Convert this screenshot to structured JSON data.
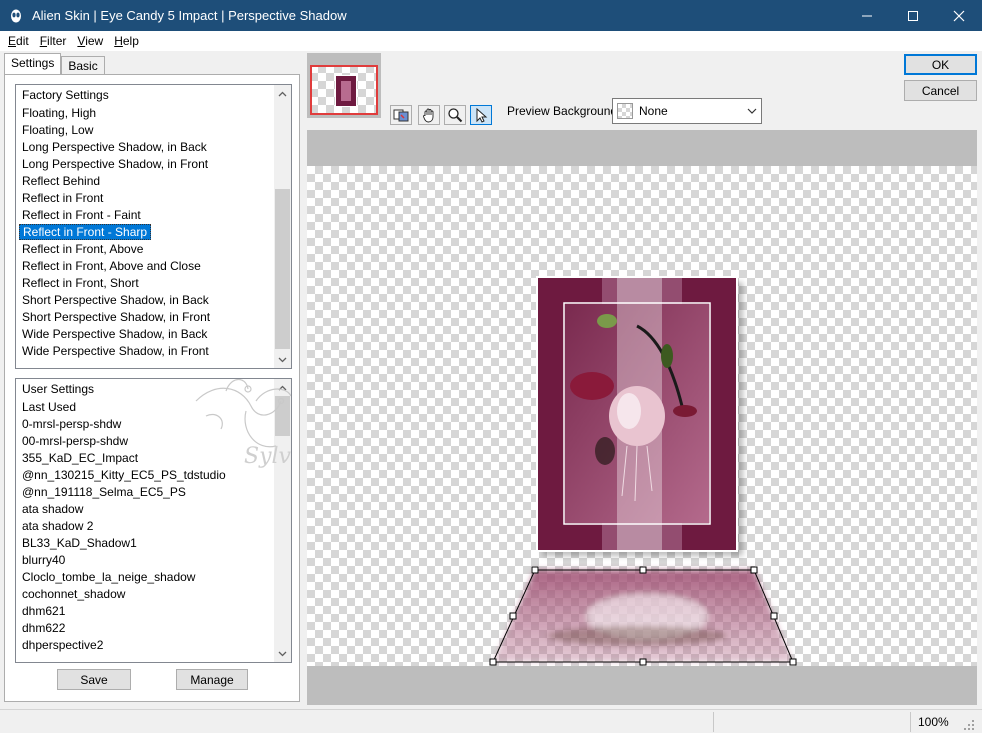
{
  "window": {
    "title": "Alien Skin | Eye Candy 5 Impact | Perspective Shadow"
  },
  "menu": [
    {
      "label": "Edit",
      "key": "E",
      "rest": "dit"
    },
    {
      "label": "Filter",
      "key": "F",
      "rest": "ilter"
    },
    {
      "label": "View",
      "key": "V",
      "rest": "iew"
    },
    {
      "label": "Help",
      "key": "H",
      "rest": "elp"
    }
  ],
  "tabs": {
    "settings": "Settings",
    "basic": "Basic"
  },
  "factory": {
    "header": "Factory Settings",
    "items": [
      "Floating, High",
      "Floating, Low",
      "Long Perspective Shadow, in Back",
      "Long Perspective Shadow, in Front",
      "Reflect Behind",
      "Reflect in Front",
      "Reflect in Front - Faint",
      "Reflect in Front - Sharp",
      "Reflect in Front, Above",
      "Reflect in Front, Above and Close",
      "Reflect in Front, Short",
      "Short Perspective Shadow, in Back",
      "Short Perspective Shadow, in Front",
      "Wide Perspective Shadow, in Back",
      "Wide Perspective Shadow, in Front"
    ],
    "selected": "Reflect in Front - Sharp"
  },
  "user": {
    "header": "User Settings",
    "items": [
      "Last Used",
      "0-mrsl-persp-shdw",
      "00-mrsl-persp-shdw",
      "355_KaD_EC_Impact",
      "@nn_130215_Kitty_EC5_PS_tdstudio",
      "@nn_191118_Selma_EC5_PS",
      "ata shadow",
      "ata shadow 2",
      "BL33_KaD_Shadow1",
      "blurry40",
      "Cloclo_tombe_la_neige_shadow",
      "cochonnet_shadow",
      "dhm621",
      "dhm622",
      "dhperspective2"
    ]
  },
  "watermark": "Sylviane",
  "buttons": {
    "save": "Save",
    "manage": "Manage",
    "ok": "OK",
    "cancel": "Cancel"
  },
  "preview": {
    "background_label": "Preview Background:",
    "background_value": "None"
  },
  "status": {
    "zoom": "100%"
  },
  "colors": {
    "titlebar": "#1e4e79",
    "selection": "#0078d7",
    "frame": "#6e1a40"
  }
}
